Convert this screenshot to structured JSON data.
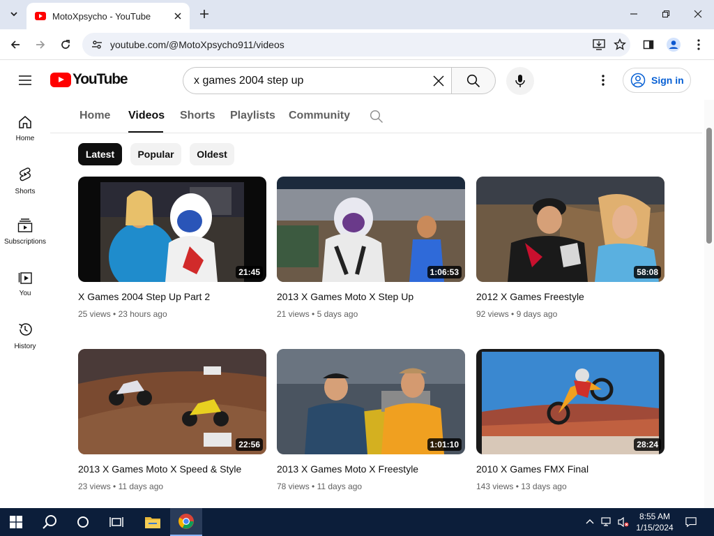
{
  "browser": {
    "tab_title": "MotoXpsycho - YouTube",
    "url": "youtube.com/@MotoXpsycho911/videos"
  },
  "masthead": {
    "logo_text": "YouTube",
    "search_query": "x games 2004 step up",
    "sign_in_label": "Sign in"
  },
  "guide": [
    {
      "label": "Home",
      "icon": "home-icon"
    },
    {
      "label": "Shorts",
      "icon": "shorts-icon"
    },
    {
      "label": "Subscriptions",
      "icon": "subscriptions-icon"
    },
    {
      "label": "You",
      "icon": "you-icon"
    },
    {
      "label": "History",
      "icon": "history-icon"
    }
  ],
  "channel_tabs": [
    "Home",
    "Videos",
    "Shorts",
    "Playlists",
    "Community"
  ],
  "active_channel_tab": "Videos",
  "chips": [
    "Latest",
    "Popular",
    "Oldest"
  ],
  "active_chip": "Latest",
  "videos": [
    {
      "title": "X Games 2004 Step Up Part 2",
      "views": "25 views",
      "age": "23 hours ago",
      "duration": "21:45"
    },
    {
      "title": "2013 X Games Moto X Step Up",
      "views": "21 views",
      "age": "5 days ago",
      "duration": "1:06:53"
    },
    {
      "title": "2012 X Games Freestyle",
      "views": "92 views",
      "age": "9 days ago",
      "duration": "58:08"
    },
    {
      "title": "2013 X Games Moto X Speed & Style",
      "views": "23 views",
      "age": "11 days ago",
      "duration": "22:56"
    },
    {
      "title": "2013 X Games Moto X Freestyle",
      "views": "78 views",
      "age": "11 days ago",
      "duration": "1:01:10"
    },
    {
      "title": "2010 X Games FMX Final",
      "views": "143 views",
      "age": "13 days ago",
      "duration": "28:24"
    }
  ],
  "taskbar": {
    "time": "8:55 AM",
    "date": "1/15/2024"
  },
  "colors": {
    "youtube_red": "#ff0000",
    "link_blue": "#065fd4",
    "taskbar": "#0c1e3a"
  }
}
